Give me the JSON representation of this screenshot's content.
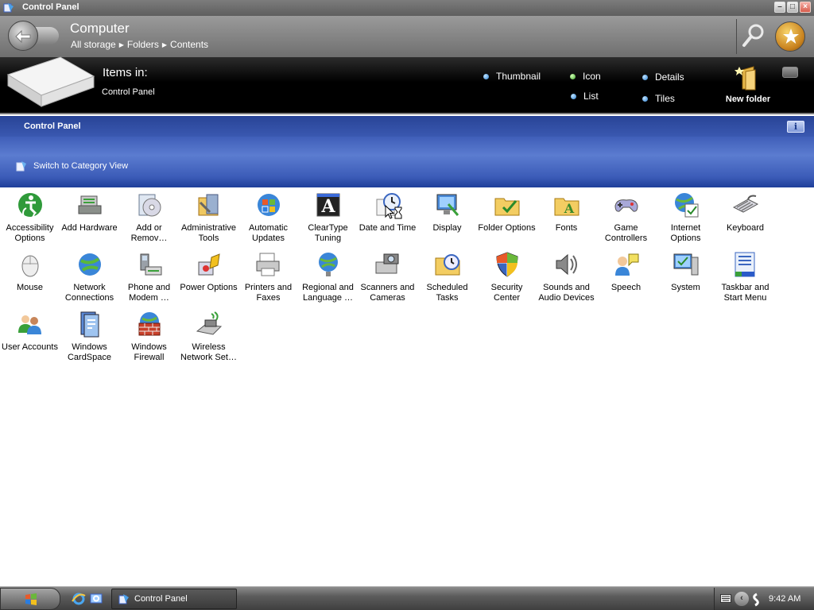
{
  "window": {
    "title": "Control Panel"
  },
  "address": {
    "title": "Computer",
    "breadcrumb": [
      "All storage",
      "Folders",
      "Contents"
    ]
  },
  "items_bar": {
    "label": "Items in:",
    "location": "Control Panel",
    "view_options": {
      "thumbnail": "Thumbnail",
      "icon": "Icon",
      "details": "Details",
      "list": "List",
      "tiles": "Tiles"
    },
    "new_folder": "New folder"
  },
  "task_header": {
    "title": "Control Panel",
    "info": "i",
    "switch_view": "Switch to Category View"
  },
  "items": [
    {
      "name": "Accessibility",
      "name2": "Options",
      "icon": "accessibility-icon"
    },
    {
      "name": "Add Hardware",
      "name2": "",
      "icon": "add-hardware-icon"
    },
    {
      "name": "Add or",
      "name2": "Remov…",
      "icon": "add-remove-programs-icon"
    },
    {
      "name": "Administrative",
      "name2": "Tools",
      "icon": "administrative-tools-icon"
    },
    {
      "name": "Automatic",
      "name2": "Updates",
      "icon": "automatic-updates-icon"
    },
    {
      "name": "ClearType",
      "name2": "Tuning",
      "icon": "cleartype-icon"
    },
    {
      "name": "Date and Time",
      "name2": "",
      "icon": "date-time-icon"
    },
    {
      "name": "Display",
      "name2": "",
      "icon": "display-icon"
    },
    {
      "name": "Folder Options",
      "name2": "",
      "icon": "folder-options-icon"
    },
    {
      "name": "Fonts",
      "name2": "",
      "icon": "fonts-icon"
    },
    {
      "name": "Game",
      "name2": "Controllers",
      "icon": "game-controllers-icon"
    },
    {
      "name": "Internet",
      "name2": "Options",
      "icon": "internet-options-icon"
    },
    {
      "name": "Keyboard",
      "name2": "",
      "icon": "keyboard-icon"
    },
    {
      "name": "Mouse",
      "name2": "",
      "icon": "mouse-icon"
    },
    {
      "name": "Network",
      "name2": "Connections",
      "icon": "network-connections-icon"
    },
    {
      "name": "Phone and",
      "name2": "Modem …",
      "icon": "phone-modem-icon"
    },
    {
      "name": "Power Options",
      "name2": "",
      "icon": "power-options-icon"
    },
    {
      "name": "Printers and",
      "name2": "Faxes",
      "icon": "printers-faxes-icon"
    },
    {
      "name": "Regional and",
      "name2": "Language …",
      "icon": "regional-language-icon"
    },
    {
      "name": "Scanners and",
      "name2": "Cameras",
      "icon": "scanners-cameras-icon"
    },
    {
      "name": "Scheduled",
      "name2": "Tasks",
      "icon": "scheduled-tasks-icon"
    },
    {
      "name": "Security",
      "name2": "Center",
      "icon": "security-center-icon"
    },
    {
      "name": "Sounds and",
      "name2": "Audio Devices",
      "icon": "sounds-audio-icon"
    },
    {
      "name": "Speech",
      "name2": "",
      "icon": "speech-icon"
    },
    {
      "name": "System",
      "name2": "",
      "icon": "system-icon"
    },
    {
      "name": "Taskbar and",
      "name2": "Start Menu",
      "icon": "taskbar-start-menu-icon"
    },
    {
      "name": "User Accounts",
      "name2": "",
      "icon": "user-accounts-icon"
    },
    {
      "name": "Windows",
      "name2": "CardSpace",
      "icon": "cardspace-icon"
    },
    {
      "name": "Windows",
      "name2": "Firewall",
      "icon": "firewall-icon"
    },
    {
      "name": "Wireless",
      "name2": "Network Set…",
      "icon": "wireless-network-icon"
    }
  ],
  "taskbar": {
    "task_label": "Control Panel",
    "clock": "9:42 AM"
  }
}
